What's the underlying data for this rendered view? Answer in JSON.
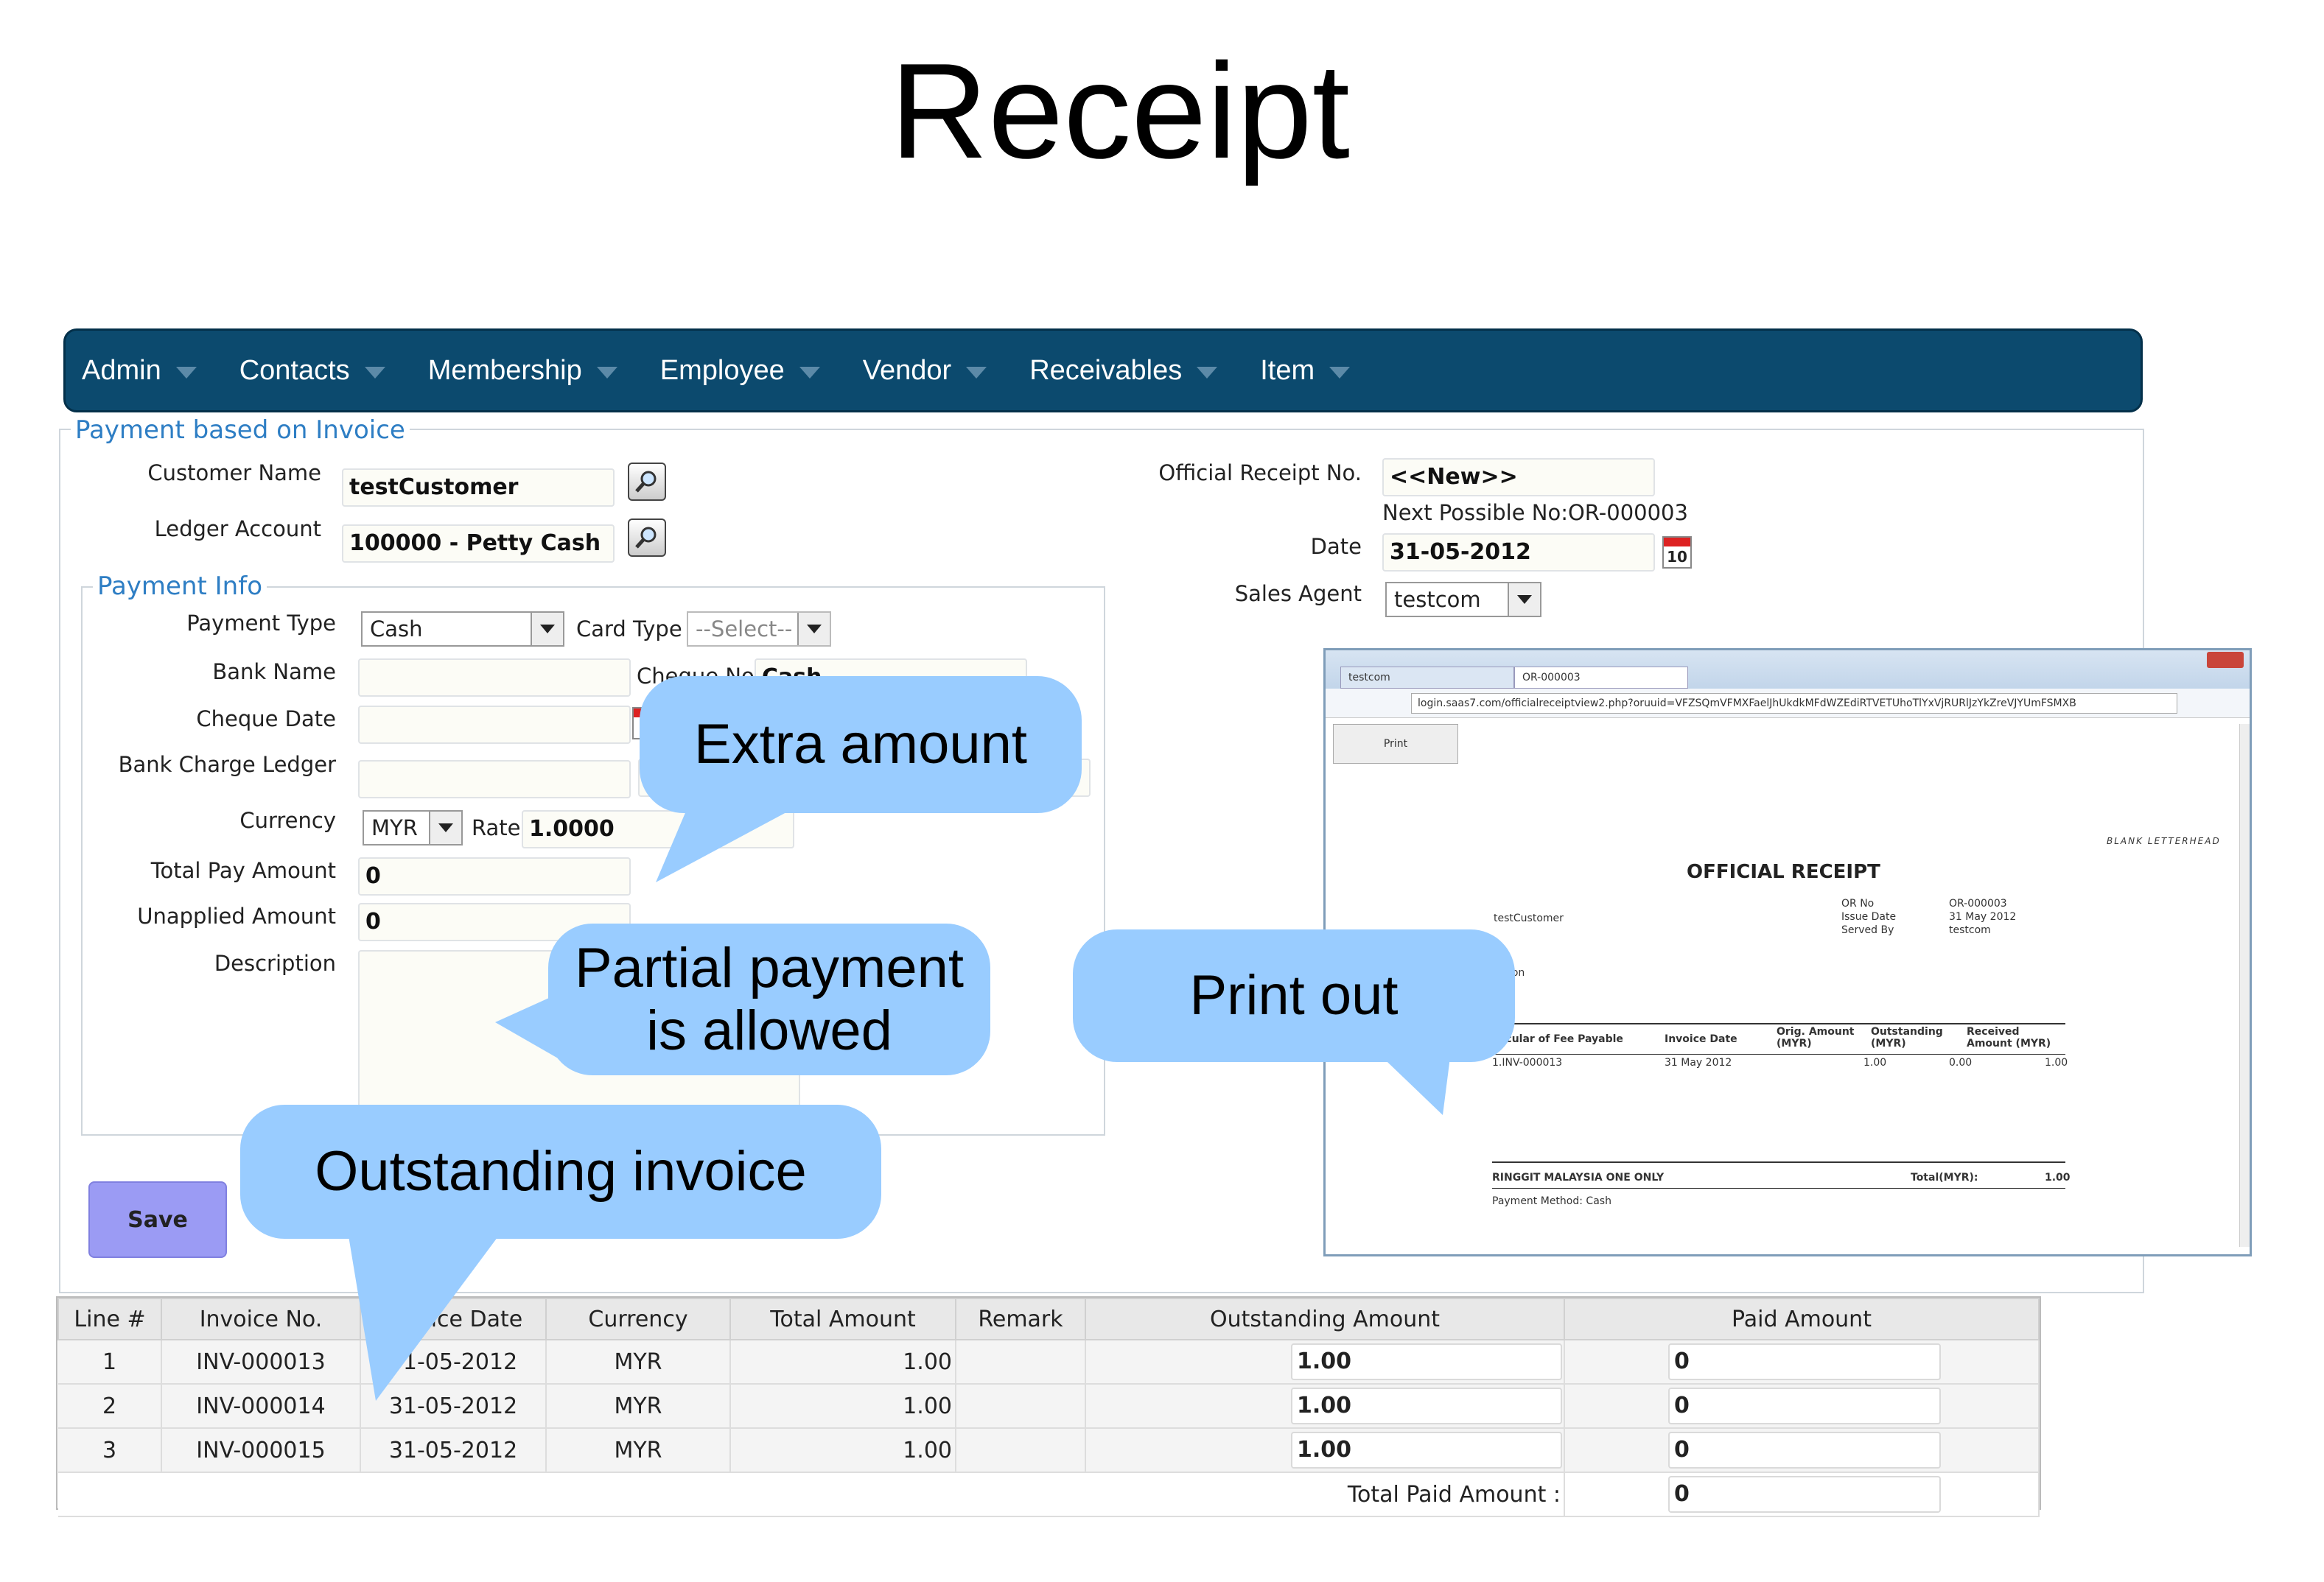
{
  "slide_title": "Receipt",
  "nav": {
    "items": [
      {
        "label": "Admin"
      },
      {
        "label": "Contacts"
      },
      {
        "label": "Membership"
      },
      {
        "label": "Employee"
      },
      {
        "label": "Vendor"
      },
      {
        "label": "Receivables"
      },
      {
        "label": "Item"
      }
    ]
  },
  "form": {
    "legend": "Payment based on Invoice",
    "customer_name_label": "Customer Name",
    "customer_name_value": "testCustomer",
    "ledger_account_label": "Ledger Account",
    "ledger_account_value": "100000 - Petty Cash",
    "official_receipt_label": "Official Receipt No.",
    "official_receipt_value": "<<New>>",
    "next_possible": "Next Possible No:OR-000003",
    "date_label": "Date",
    "date_value": "31-05-2012",
    "calendar_day": "10",
    "sales_agent_label": "Sales Agent",
    "sales_agent_value": "testcom"
  },
  "payment_info": {
    "legend": "Payment Info",
    "payment_type_label": "Payment Type",
    "payment_type_value": "Cash",
    "card_type_label": "Card Type",
    "card_type_value": "--Select--",
    "bank_name_label": "Bank Name",
    "cheque_no_label": "Cheque No.",
    "cheque_no_value": "Cash",
    "cheque_date_label": "Cheque Date",
    "bank_charge_label": "Bank Charge Ledger",
    "currency_label": "Currency",
    "currency_value": "MYR",
    "rate_label": "Rate",
    "rate_value": "1.0000",
    "total_pay_label": "Total Pay Amount",
    "total_pay_value": "0",
    "unapplied_label": "Unapplied Amount",
    "unapplied_value": "0",
    "description_label": "Description"
  },
  "save_label": "Save",
  "bubbles": {
    "extra": "Extra amount",
    "partial_1": "Partial payment",
    "partial_2": "is allowed",
    "outstanding": "Outstanding invoice",
    "printout": "Print out"
  },
  "table": {
    "headers": [
      "Line #",
      "Invoice No.",
      "Invoice Date",
      "Currency",
      "Total Amount",
      "Remark",
      "Outstanding Amount",
      "Paid Amount"
    ],
    "rows": [
      {
        "line": "1",
        "invoice": "INV-000013",
        "date": "31-05-2012",
        "currency": "MYR",
        "total": "1.00",
        "remark": "",
        "outstanding": "1.00",
        "paid": "0"
      },
      {
        "line": "2",
        "invoice": "INV-000014",
        "date": "31-05-2012",
        "currency": "MYR",
        "total": "1.00",
        "remark": "",
        "outstanding": "1.00",
        "paid": "0"
      },
      {
        "line": "3",
        "invoice": "INV-000015",
        "date": "31-05-2012",
        "currency": "MYR",
        "total": "1.00",
        "remark": "",
        "outstanding": "1.00",
        "paid": "0"
      }
    ],
    "total_paid_label": "Total Paid Amount :",
    "total_paid_value": "0"
  },
  "browser": {
    "tab1": "testcom",
    "tab2": "OR-000003",
    "url": "login.saas7.com/officialreceiptview2.php?oruuid=VFZSQmVFMXFaelJhUkdkMFdWZEdiRTVETUhoTlYxVjRURlJzYkZreVJYUmFSMXB",
    "print_button": "Print",
    "letterhead": "BLANK LETTERHEAD",
    "receipt_title": "OFFICIAL RECEIPT",
    "customer": "testCustomer",
    "or_no_label": "OR No",
    "or_no_value": "OR-000003",
    "issue_date_label": "Issue Date",
    "issue_date_value": "31 May 2012",
    "served_by_label": "Served By",
    "served_by_value": "testcom",
    "attention": "ention",
    "col_particular": "rticular of Fee Payable",
    "col_invoice_date": "Invoice Date",
    "col_org_1": "Orig. Amount",
    "col_org_2": "(MYR)",
    "col_outstanding_1": "Outstanding",
    "col_outstanding_2": "(MYR)",
    "col_received_1": "Received",
    "col_received_2": "Amount (MYR)",
    "row_invoice": "1.INV-000013",
    "row_date": "31 May 2012",
    "row_orig": "1.00",
    "row_outstanding": "0.00",
    "row_received": "1.00",
    "amount_words": "RINGGIT MALAYSIA ONE ONLY",
    "total_label": "Total(MYR):",
    "total_value": "1.00",
    "payment_method": "Payment Method: Cash"
  }
}
